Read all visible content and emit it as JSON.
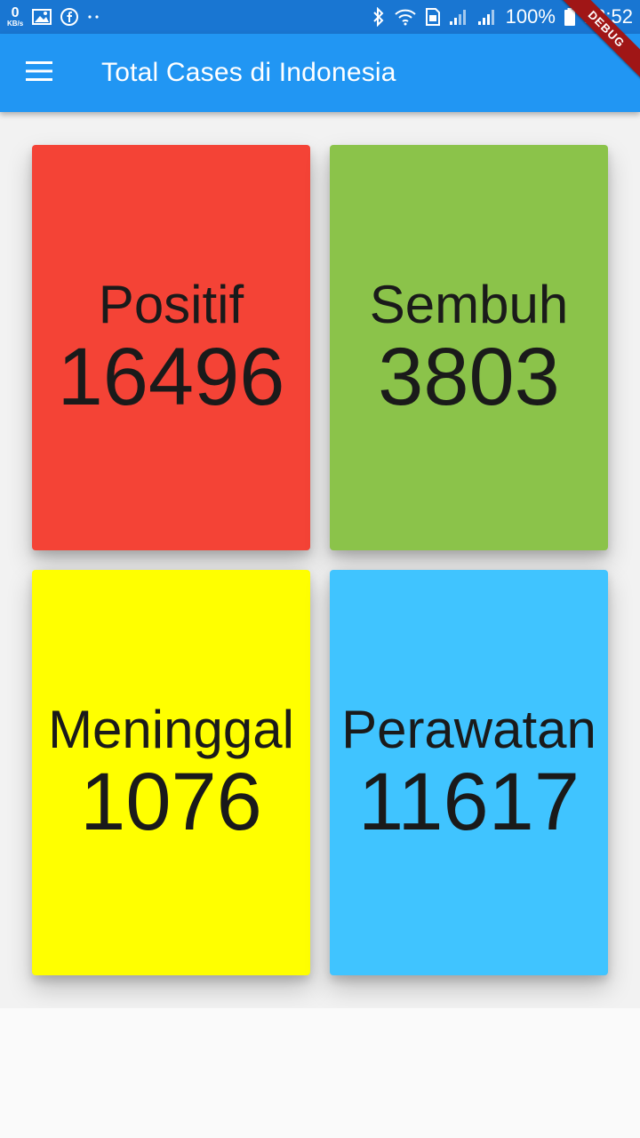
{
  "status_bar": {
    "net_speed_value": "0",
    "net_speed_unit": "KB/s",
    "left_icons": [
      "gallery-icon",
      "facebook-icon",
      "more-dots-icon"
    ],
    "right_icons": [
      "bluetooth-icon",
      "wifi-icon",
      "signal-icon",
      "signal-icon"
    ],
    "battery": "100%",
    "time": "18:52"
  },
  "app_bar": {
    "title": "Total Cases di Indonesia",
    "menu_icon": "hamburger-menu-icon",
    "debug_banner": "DEBUG"
  },
  "stats": [
    {
      "label": "Positif",
      "value": "16496",
      "color": "#f44336"
    },
    {
      "label": "Sembuh",
      "value": "3803",
      "color": "#8bc34a"
    },
    {
      "label": "Meninggal",
      "value": "1076",
      "color": "#ffff00"
    },
    {
      "label": "Perawatan",
      "value": "11617",
      "color": "#40c4ff"
    }
  ]
}
